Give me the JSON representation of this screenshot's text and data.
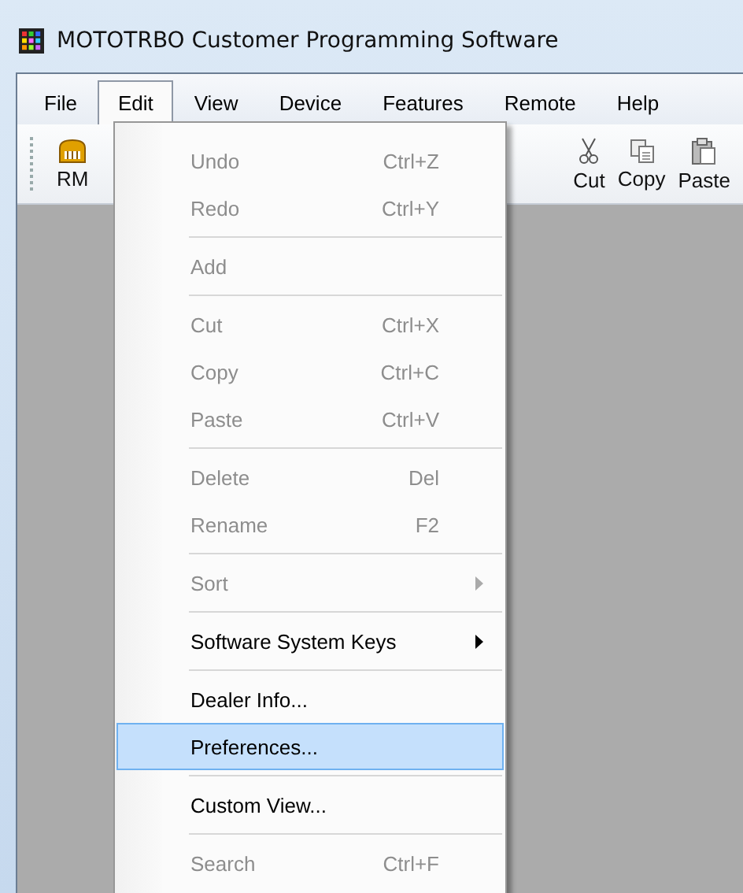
{
  "window": {
    "title": "MOTOTRBO Customer Programming Software"
  },
  "menu_bar": [
    {
      "label": "File",
      "selected": false
    },
    {
      "label": "Edit",
      "selected": true
    },
    {
      "label": "View",
      "selected": false
    },
    {
      "label": "Device",
      "selected": false
    },
    {
      "label": "Features",
      "selected": false
    },
    {
      "label": "Remote",
      "selected": false
    },
    {
      "label": "Help",
      "selected": false
    }
  ],
  "toolbar": [
    {
      "kind": "rm",
      "label": "RM"
    },
    {
      "kind": "cut",
      "label": "Cut"
    },
    {
      "kind": "copy",
      "label": "Copy"
    },
    {
      "kind": "paste",
      "label": "Paste"
    }
  ],
  "edit_menu": [
    {
      "kind": "item",
      "label": "Undo",
      "shortcut": "Ctrl+Z",
      "disabled": true,
      "submenu": false,
      "selected": false
    },
    {
      "kind": "item",
      "label": "Redo",
      "shortcut": "Ctrl+Y",
      "disabled": true,
      "submenu": false,
      "selected": false
    },
    {
      "kind": "separator"
    },
    {
      "kind": "item",
      "label": "Add",
      "disabled": true,
      "submenu": false,
      "selected": false
    },
    {
      "kind": "separator"
    },
    {
      "kind": "item",
      "label": "Cut",
      "shortcut": "Ctrl+X",
      "disabled": true,
      "submenu": false,
      "selected": false
    },
    {
      "kind": "item",
      "label": "Copy",
      "shortcut": "Ctrl+C",
      "disabled": true,
      "submenu": false,
      "selected": false
    },
    {
      "kind": "item",
      "label": "Paste",
      "shortcut": "Ctrl+V",
      "disabled": true,
      "submenu": false,
      "selected": false
    },
    {
      "kind": "separator"
    },
    {
      "kind": "item",
      "label": "Delete",
      "shortcut": "Del",
      "disabled": true,
      "submenu": false,
      "selected": false
    },
    {
      "kind": "item",
      "label": "Rename",
      "shortcut": "F2",
      "disabled": true,
      "submenu": false,
      "selected": false
    },
    {
      "kind": "separator"
    },
    {
      "kind": "item",
      "label": "Sort",
      "disabled": true,
      "submenu": true,
      "selected": false
    },
    {
      "kind": "separator"
    },
    {
      "kind": "item",
      "label": "Software System Keys",
      "disabled": false,
      "submenu": true,
      "selected": false
    },
    {
      "kind": "separator"
    },
    {
      "kind": "item",
      "label": "Dealer Info...",
      "disabled": false,
      "submenu": false,
      "selected": false
    },
    {
      "kind": "item",
      "label": "Preferences...",
      "disabled": false,
      "submenu": false,
      "selected": true
    },
    {
      "kind": "separator"
    },
    {
      "kind": "item",
      "label": "Custom View...",
      "disabled": false,
      "submenu": false,
      "selected": false
    },
    {
      "kind": "separator"
    },
    {
      "kind": "item",
      "label": "Search",
      "shortcut": "Ctrl+F",
      "disabled": true,
      "submenu": false,
      "selected": false
    }
  ]
}
